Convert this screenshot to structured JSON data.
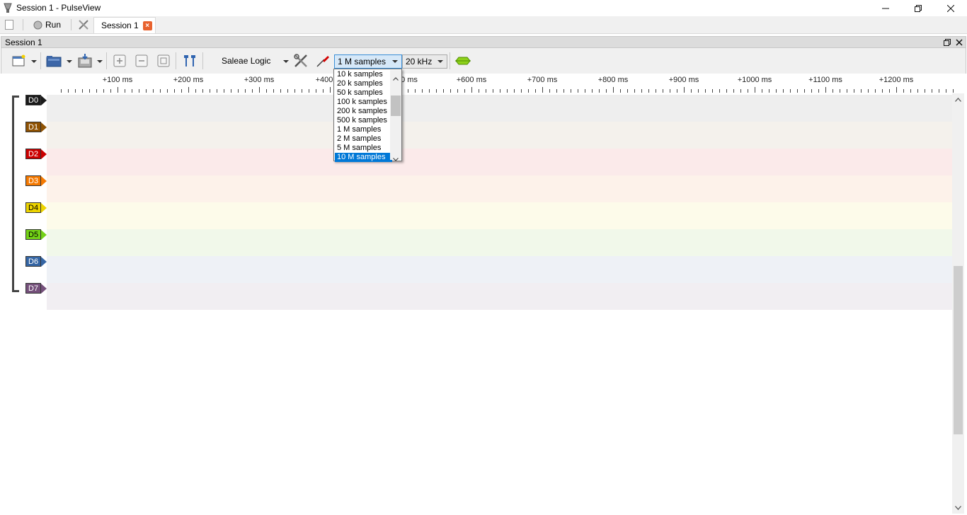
{
  "window": {
    "title": "Session 1 - PulseView",
    "controls": [
      "minimize",
      "restore",
      "close"
    ]
  },
  "tabbar": {
    "run_label": "Run",
    "session_tab_label": "Session 1"
  },
  "dock": {
    "title": "Session 1"
  },
  "toolbar": {
    "device": "Saleae Logic",
    "sample_count": "1 M samples",
    "sample_rate": "20 kHz"
  },
  "ruler": {
    "labels": [
      "+100 ms",
      "+200 ms",
      "+300 ms",
      "+400",
      "+600 ms",
      "+700 ms",
      "+800 ms",
      "+900 ms",
      "+1000 ms",
      "+1100 ms",
      "+1200 ms"
    ],
    "partial_label": "0 ms"
  },
  "channels": [
    {
      "name": "D0",
      "color": "#1a1a1a",
      "lane": "#eeeeee"
    },
    {
      "name": "D1",
      "color": "#8f5202",
      "lane": "#f4f1ec"
    },
    {
      "name": "D2",
      "color": "#cc0000",
      "lane": "#fbeaea"
    },
    {
      "name": "D3",
      "color": "#f57900",
      "lane": "#fdf2ea"
    },
    {
      "name": "D4",
      "color": "#edd400",
      "lane": "#fdfbea"
    },
    {
      "name": "D5",
      "color": "#73d216",
      "lane": "#f1f8ea"
    },
    {
      "name": "D6",
      "color": "#3465a4",
      "lane": "#eef1f6"
    },
    {
      "name": "D7",
      "color": "#75507b",
      "lane": "#f1eef2"
    }
  ],
  "sample_dropdown": {
    "options": [
      "10 k samples",
      "20 k samples",
      "50 k samples",
      "100 k samples",
      "200 k samples",
      "500 k samples",
      "1 M samples",
      "2 M samples",
      "5 M samples",
      "10 M samples"
    ],
    "highlighted": "10 M samples"
  }
}
